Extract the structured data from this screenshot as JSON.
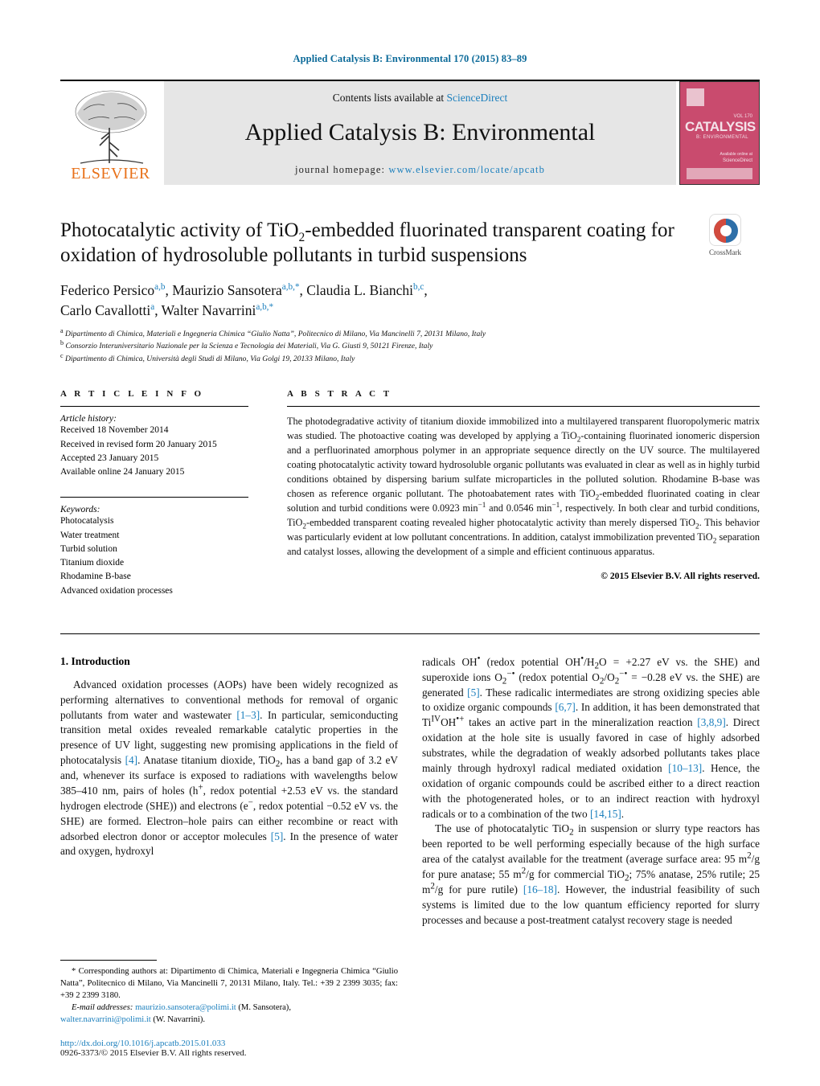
{
  "running_head": "Applied Catalysis B: Environmental 170 (2015) 83–89",
  "masthead": {
    "publisher_name": "ELSEVIER",
    "contents_prefix": "Contents lists available at ",
    "sciencedirect": "ScienceDirect",
    "journal_title": "Applied Catalysis B: Environmental",
    "homepage_prefix": "journal homepage: ",
    "homepage_url": "www.elsevier.com/locate/apcatb",
    "cover": {
      "title": "CATALYSIS",
      "subtitle": "B: ENVIRONMENTAL",
      "superscript": "VOL 170",
      "sciencedirect": "Available online at",
      "sciencedirect2": "ScienceDirect"
    }
  },
  "article": {
    "title_line1": "Photocatalytic activity of TiO",
    "title_sub1": "2",
    "title_line1b": "-embedded fluorinated transparent",
    "title_line2": "coating for oxidation of hydrosoluble pollutants in turbid suspensions",
    "crossmark_label": "CrossMark",
    "authors_line1": "Federico Persico",
    "authors_sup1": "a,b",
    "authors_line2": ", Maurizio Sansotera",
    "authors_sup2": "a,b,*",
    "authors_line3": ", Claudia L. Bianchi",
    "authors_sup3": "b,c",
    "authors_line4": ",",
    "authors_line5": "Carlo Cavallotti",
    "authors_sup5": "a",
    "authors_line6": ", Walter Navarrini",
    "authors_sup6": "a,b,*",
    "affiliations": [
      {
        "mark": "a",
        "text": "Dipartimento di Chimica, Materiali e Ingegneria Chimica “Giulio Natta”, Politecnico di Milano, Via Mancinelli 7, 20131 Milano, Italy"
      },
      {
        "mark": "b",
        "text": "Consorzio Interuniversitario Nazionale per la Scienza e Tecnologia dei Materiali, Via G. Giusti 9, 50121 Firenze, Italy"
      },
      {
        "mark": "c",
        "text": "Dipartimento di Chimica, Università degli Studi di Milano, Via Golgi 19, 20133 Milano, Italy"
      }
    ]
  },
  "article_info": {
    "heading": "A R T I C L E   I N F O",
    "history_title": "Article history:",
    "history": [
      "Received 18 November 2014",
      "Received in revised form 20 January 2015",
      "Accepted 23 January 2015",
      "Available online 24 January 2015"
    ],
    "keywords_title": "Keywords:",
    "keywords": [
      "Photocatalysis",
      "Water treatment",
      "Turbid solution",
      "Titanium dioxide",
      "Rhodamine B-base",
      "Advanced oxidation processes"
    ]
  },
  "abstract": {
    "heading": "A B S T R A C T",
    "p1_a": "The photodegradative activity of titanium dioxide immobilized into a multilayered transparent fluoropolymeric matrix was studied. The photoactive coating was developed by applying a TiO",
    "p1_sub1": "2",
    "p1_b": "-containing fluorinated ionomeric dispersion and a perfluorinated amorphous polymer in an appropriate sequence directly on the UV source. The multilayered coating photocatalytic activity toward hydrosoluble organic pollutants was evaluated in clear as well as in highly turbid conditions obtained by dispersing barium sulfate microparticles in the polluted solution. Rhodamine B-base was chosen as reference organic pollutant. The photoabatement rates with TiO",
    "p1_sub2": "2",
    "p1_c": "-embedded fluorinated coating in clear solution and turbid conditions were 0.0923 min",
    "p1_sup1": "−1",
    "p1_d": " and 0.0546 min",
    "p1_sup2": "−1",
    "p1_e": ", respectively. In both clear and turbid conditions, TiO",
    "p1_sub3": "2",
    "p1_f": "-embedded transparent coating revealed higher photocatalytic activity than merely dispersed TiO",
    "p1_sub4": "2",
    "p1_g": ". This behavior was particularly evident at low pollutant concentrations. In addition, catalyst immobilization prevented TiO",
    "p1_sub5": "2",
    "p1_h": " separation and catalyst losses, allowing the development of a simple and efficient continuous apparatus.",
    "copyright": "© 2015 Elsevier B.V. All rights reserved."
  },
  "introduction": {
    "section_number": "1.",
    "section_title": "Introduction",
    "left_p1_a": "Advanced oxidation processes (AOPs) have been widely recognized as performing alternatives to conventional methods for removal of organic pollutants from water and wastewater ",
    "left_ref1": "[1–3]",
    "left_p1_b": ". In particular, semiconducting transition metal oxides revealed remarkable catalytic properties in the presence of UV light, suggesting new promising applications in the field of photocatalysis ",
    "left_ref2": "[4]",
    "left_p1_c": ". Anatase titanium dioxide, TiO",
    "left_sub1": "2",
    "left_p1_d": ", has a band gap of 3.2 eV and, whenever its surface is exposed to radiations with wavelengths below 385–410 nm, pairs of holes (h",
    "left_sup1": "+",
    "left_p1_e": ", redox potential +2.53 eV vs. the standard hydrogen electrode (SHE)) and electrons (e",
    "left_sup2": "−",
    "left_p1_f": ", redox potential −0.52 eV vs. the SHE) are formed. Electron–hole pairs can either recombine or react with adsorbed electron donor or acceptor molecules ",
    "left_ref3": "[5]",
    "left_p1_g": ". In the presence of water and oxygen, hydroxyl",
    "right_p1_a": "radicals OH",
    "right_sup0": "•",
    "right_p1_b": " (redox potential OH",
    "right_sup0b": "•",
    "right_p1_c": "/H",
    "right_sub0": "2",
    "right_p1_d": "O = +2.27 eV vs. the SHE) and superoxide ions O",
    "right_sub1": "2",
    "right_sup1": "−•",
    "right_p1_e": " (redox potential O",
    "right_sub2": "2",
    "right_p1_f": "/O",
    "right_sub3": "2",
    "right_sup3": "−•",
    "right_p1_g": " = −0.28 eV vs. the SHE) are generated ",
    "right_ref1": "[5]",
    "right_p1_h": ". These radicalic intermediates are strong oxidizing species able to oxidize organic compounds ",
    "right_ref2": "[6,7]",
    "right_p1_i": ". In addition, it has been demonstrated that Ti",
    "right_sup4": "IV",
    "right_p1_j": "OH",
    "right_sup5": "•+",
    "right_p1_k": " takes an active part in the mineralization reaction ",
    "right_ref3": "[3,8,9]",
    "right_p1_l": ". Direct oxidation at the hole site is usually favored in case of highly adsorbed substrates, while the degradation of weakly adsorbed pollutants takes place mainly through hydroxyl radical mediated oxidation ",
    "right_ref4": "[10–13]",
    "right_p1_m": ". Hence, the oxidation of organic compounds could be ascribed either to a direct reaction with the photogenerated holes, or to an indirect reaction with hydroxyl radicals or to a combination of the two ",
    "right_ref5": "[14,15]",
    "right_p1_n": ".",
    "right_p2_a": "The use of photocatalytic TiO",
    "right_p2_sub1": "2",
    "right_p2_b": " in suspension or slurry type reactors has been reported to be well performing especially because of the high surface area of the catalyst available for the treatment (average surface area: 95 m",
    "right_p2_sup1": "2",
    "right_p2_c": "/g for pure anatase; 55 m",
    "right_p2_sup2": "2",
    "right_p2_d": "/g for commercial TiO",
    "right_p2_sub2": "2",
    "right_p2_e": "; 75% anatase, 25% rutile; 25 m",
    "right_p2_sup3": "2",
    "right_p2_f": "/g for pure rutile) ",
    "right_ref6": "[16–18]",
    "right_p2_g": ". However, the industrial feasibility of such systems is limited due to the low quantum efficiency reported for slurry processes and because a post-treatment catalyst recovery stage is needed"
  },
  "footnotes": {
    "corresponding_a": "* Corresponding authors at: Dipartimento di Chimica, Materiali e Ingegneria Chimica “Giulio Natta”, Politecnico di Milano, Via Mancinelli 7, 20131 Milano, Italy. Tel.: +39 2 2399 3035; fax: +39 2 2399 3180.",
    "email_label": "E-mail addresses:",
    "email1": "maurizio.sansotera@polimi.it",
    "email1_name": " (M. Sansotera),",
    "email2": "walter.navarrini@polimi.it",
    "email2_name": " (W. Navarrini).",
    "doi": "http://dx.doi.org/10.1016/j.apcatb.2015.01.033",
    "issn_a": "0926-3373/",
    "issn_b": "© 2015 Elsevier B.V. All rights reserved."
  },
  "colors": {
    "link": "#1b7fbd",
    "elsevier_orange": "#E8711A",
    "cover_pink": "#c94b6e",
    "band_gray": "#e6e6e6"
  }
}
